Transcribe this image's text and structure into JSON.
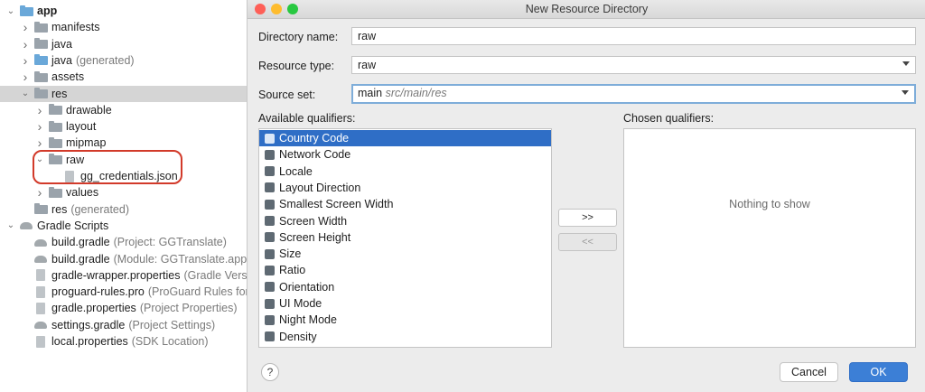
{
  "project_tree": {
    "items": [
      {
        "label": "app",
        "bold": true,
        "chevron": "down",
        "icon": "app-module-icon",
        "indent": 0
      },
      {
        "label": "manifests",
        "chevron": "right",
        "icon": "folder-icon",
        "indent": 1
      },
      {
        "label": "java",
        "chevron": "right",
        "icon": "folder-icon",
        "indent": 1
      },
      {
        "label": "java",
        "suffix": "(generated)",
        "chevron": "right",
        "icon": "generated-folder-icon",
        "indent": 1
      },
      {
        "label": "assets",
        "chevron": "right",
        "icon": "resource-folder-icon",
        "indent": 1
      },
      {
        "label": "res",
        "chevron": "down",
        "icon": "resource-folder-icon",
        "indent": 1,
        "selected": true
      },
      {
        "label": "drawable",
        "chevron": "right",
        "icon": "folder-icon",
        "indent": 2
      },
      {
        "label": "layout",
        "chevron": "right",
        "icon": "folder-icon",
        "indent": 2
      },
      {
        "label": "mipmap",
        "chevron": "right",
        "icon": "folder-icon",
        "indent": 2
      },
      {
        "label": "raw",
        "chevron": "down",
        "icon": "folder-icon",
        "indent": 2
      },
      {
        "label": "gg_credentials.json",
        "chevron": "",
        "icon": "json-file-icon",
        "indent": 3
      },
      {
        "label": "values",
        "chevron": "right",
        "icon": "folder-icon",
        "indent": 2
      },
      {
        "label": "res",
        "suffix": "(generated)",
        "chevron": "",
        "icon": "resource-folder-icon",
        "indent": 1
      },
      {
        "label": "Gradle Scripts",
        "chevron": "down",
        "icon": "gradle-icon",
        "indent": 0
      },
      {
        "label": "build.gradle",
        "suffix": "(Project: GGTranslate)",
        "chevron": "",
        "icon": "gradle-icon",
        "indent": 1
      },
      {
        "label": "build.gradle",
        "suffix": "(Module: GGTranslate.app)",
        "chevron": "",
        "icon": "gradle-icon",
        "indent": 1
      },
      {
        "label": "gradle-wrapper.properties",
        "suffix": "(Gradle Version)",
        "chevron": "",
        "icon": "properties-file-icon",
        "indent": 1
      },
      {
        "label": "proguard-rules.pro",
        "suffix": "(ProGuard Rules for GGTranslate.app)",
        "chevron": "",
        "icon": "text-file-icon",
        "indent": 1
      },
      {
        "label": "gradle.properties",
        "suffix": "(Project Properties)",
        "chevron": "",
        "icon": "properties-file-icon",
        "indent": 1
      },
      {
        "label": "settings.gradle",
        "suffix": "(Project Settings)",
        "chevron": "",
        "icon": "gradle-icon",
        "indent": 1
      },
      {
        "label": "local.properties",
        "suffix": "(SDK Location)",
        "chevron": "",
        "icon": "properties-file-icon",
        "indent": 1
      }
    ]
  },
  "dialog": {
    "title": "New Resource Directory",
    "directory_name_label": "Directory name:",
    "directory_name_value": "raw",
    "resource_type_label": "Resource type:",
    "resource_type_value": "raw",
    "source_set_label": "Source set:",
    "source_set_value": "main",
    "source_set_path": "src/main/res",
    "available_label": "Available qualifiers:",
    "chosen_label": "Chosen qualifiers:",
    "available_qualifiers": [
      "Country Code",
      "Network Code",
      "Locale",
      "Layout Direction",
      "Smallest Screen Width",
      "Screen Width",
      "Screen Height",
      "Size",
      "Ratio",
      "Orientation",
      "UI Mode",
      "Night Mode",
      "Density"
    ],
    "selected_qualifier_index": 0,
    "chosen_empty_text": "Nothing to show",
    "add_button": ">>",
    "remove_button": "<<",
    "help_button": "?",
    "cancel_button": "Cancel",
    "ok_button": "OK"
  },
  "colors": {
    "selection_blue": "#2f6ec6",
    "ok_blue": "#3c7fd6",
    "highlight_red": "#d23a2a",
    "traffic_close": "#fe5f57",
    "traffic_min": "#febc2e",
    "traffic_max": "#28c840"
  }
}
